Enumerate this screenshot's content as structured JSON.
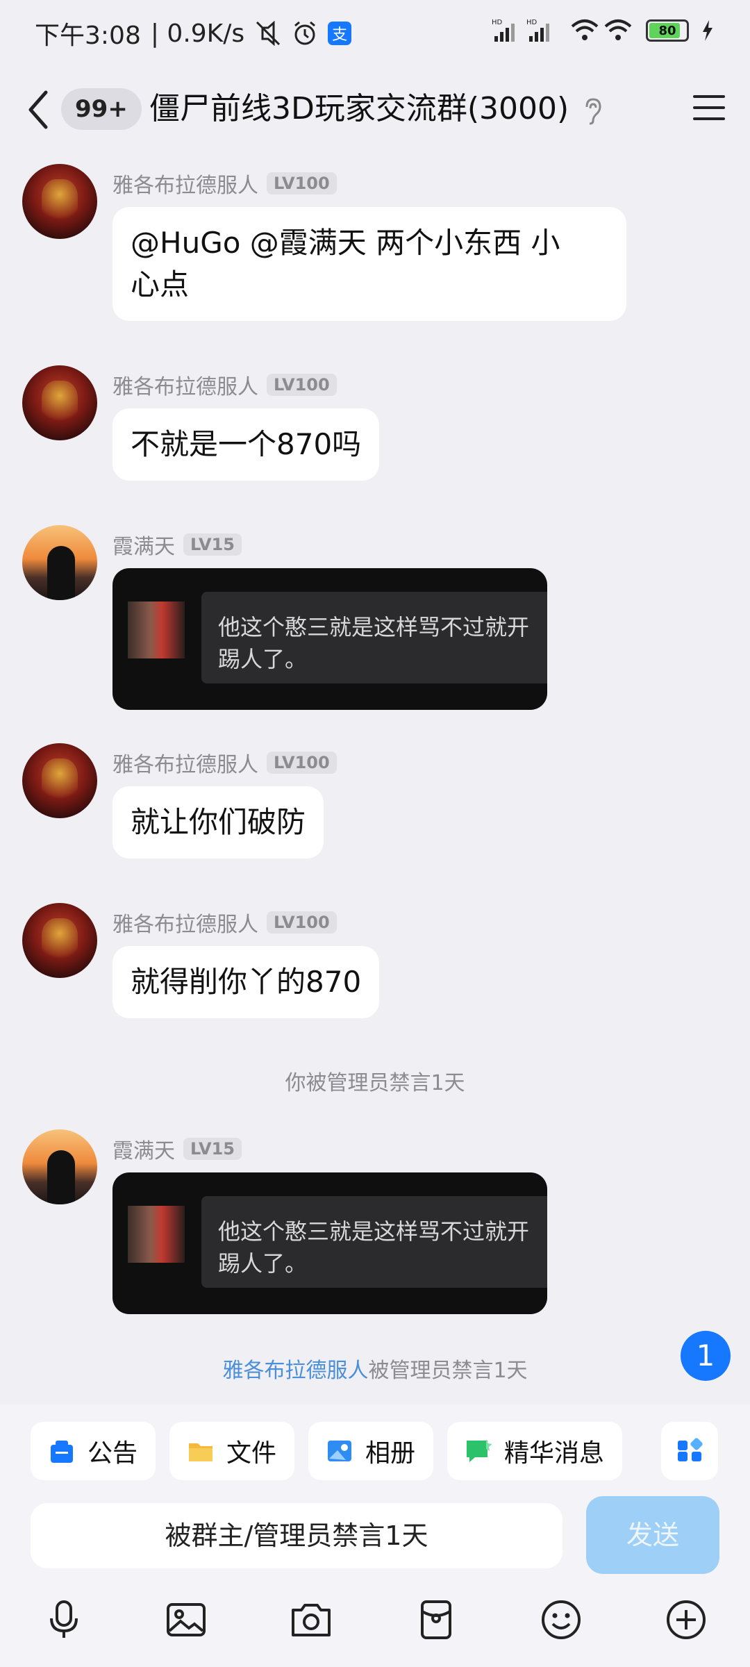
{
  "status_bar": {
    "time": "下午3:08",
    "speed": "| 0.9K/s",
    "battery": "80",
    "icons": [
      "mute-icon",
      "alarm-icon",
      "alipay-icon",
      "hd-signal-icon",
      "wifi-icon",
      "battery-icon",
      "charging-icon"
    ]
  },
  "header": {
    "unread": "99+",
    "title": "僵尸前线3D玩家交流群(3000)"
  },
  "messages": [
    {
      "sender": "雅各布拉德服人",
      "level": "LV100",
      "text": "@HuGo @霞满天 两个小东西 小\n心点"
    },
    {
      "sender": "雅各布拉德服人",
      "level": "LV100",
      "text": "不就是一个870吗"
    },
    {
      "sender": "霞满天",
      "level": "LV15",
      "card_text": "他这个憨三就是这样骂不过就开\n踢人了。"
    },
    {
      "sender": "雅各布拉德服人",
      "level": "LV100",
      "text": "就让你们破防"
    },
    {
      "sender": "雅各布拉德服人",
      "level": "LV100",
      "text": "就得削你丫的870"
    },
    {
      "sender": "霞满天",
      "level": "LV15",
      "card_text": "他这个憨三就是这样骂不过就开\n踢人了。"
    }
  ],
  "notices": {
    "mute_self": "你被管理员禁言1天",
    "mute_user_name": "雅各布拉德服人",
    "mute_user_suffix": "被管理员禁言1天"
  },
  "float_badge": "1",
  "quick_actions": [
    {
      "label": "公告",
      "icon": "announcement-icon",
      "color": "#1677ff"
    },
    {
      "label": "文件",
      "icon": "folder-icon",
      "color": "#f5b93b"
    },
    {
      "label": "相册",
      "icon": "album-icon",
      "color": "#2f8cf0"
    },
    {
      "label": "精华消息",
      "icon": "highlight-icon",
      "color": "#2cc26a"
    }
  ],
  "input": {
    "value": "被群主/管理员禁言1天",
    "send_label": "发送"
  },
  "toolbar": [
    "microphone-icon",
    "image-icon",
    "camera-icon",
    "red-packet-icon",
    "emoji-icon",
    "plus-icon"
  ]
}
